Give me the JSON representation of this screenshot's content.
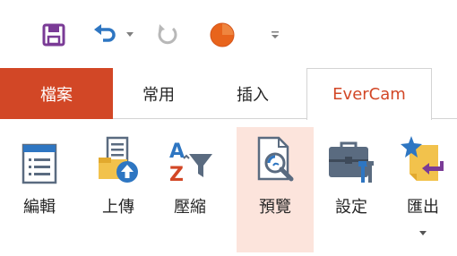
{
  "quick_access": {
    "items": [
      {
        "icon": "save-icon"
      },
      {
        "icon": "undo-icon"
      },
      {
        "icon": "undo-dropdown-icon"
      },
      {
        "icon": "redo-icon"
      },
      {
        "icon": "record-icon"
      },
      {
        "icon": "customize-toolbar-icon"
      }
    ]
  },
  "tabs": [
    {
      "label": "檔案",
      "state": "file"
    },
    {
      "label": "常用",
      "state": "normal"
    },
    {
      "label": "插入",
      "state": "normal"
    },
    {
      "label": "EverCam",
      "state": "selected"
    }
  ],
  "ribbon": {
    "buttons": [
      {
        "label": "編輯",
        "icon": "edit-list-icon"
      },
      {
        "label": "上傳",
        "icon": "upload-icon"
      },
      {
        "label": "壓縮",
        "icon": "compress-icon"
      },
      {
        "label": "預覽",
        "icon": "preview-icon",
        "state": "highlighted"
      },
      {
        "label": "設定",
        "icon": "settings-toolbox-icon"
      },
      {
        "label": "匯出",
        "icon": "export-icon",
        "has_dropdown": true
      }
    ]
  },
  "colors": {
    "accent": "#d24726",
    "highlight": "#fce4dc",
    "save_purple": "#7a3b96",
    "undo_blue": "#2e76c2",
    "record_orange": "#e8641c"
  }
}
